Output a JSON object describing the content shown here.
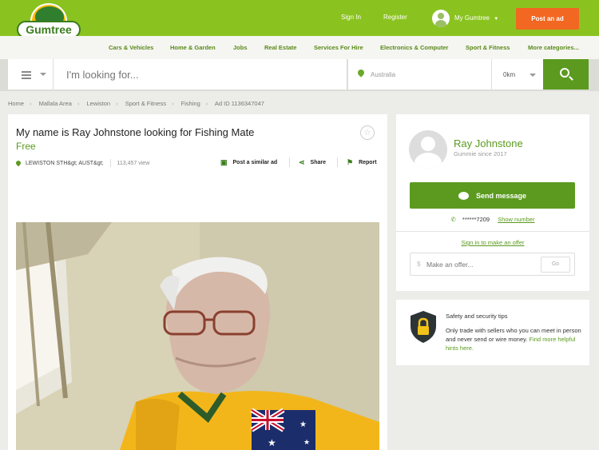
{
  "header": {
    "logo_text": "Gumtree",
    "sign_in": "Sign In",
    "register": "Register",
    "my_gumtree": "My Gumtree",
    "post_ad": "Post an ad"
  },
  "categories": [
    "Cars & Vehicles",
    "Home & Garden",
    "Jobs",
    "Real Estate",
    "Services For Hire",
    "Electronics & Computer",
    "Sport & Fitness",
    "More categories..."
  ],
  "search": {
    "placeholder": "I'm looking for...",
    "location": "Australia",
    "radius": "0km"
  },
  "breadcrumb": [
    "Home",
    "Mallala Area",
    "Lewiston",
    "Sport & Fitness",
    "Fishing",
    "Ad ID 1136347047"
  ],
  "ad": {
    "title": "My name is Ray Johnstone looking for Fishing Mate",
    "price": "Free",
    "location": "LEWISTON STH&gt; AUST&gt;",
    "views": "113,457 view",
    "post_similar": "Post a similar ad",
    "share": "Share",
    "report": "Report"
  },
  "seller": {
    "name": "Ray Johnstone",
    "since": "Gummie since 2017",
    "send_message": "Send message",
    "phone_masked": "******7209",
    "show_number": "Show number",
    "sign_in_offer": "Sign in to make an offer",
    "offer_currency": "$",
    "offer_placeholder": "Make an offer...",
    "go": "Go"
  },
  "safety": {
    "title": "Safety and security tips",
    "text": "Only trade with sellers who you can meet in person and never send or wire money.",
    "link": "Find more helpful hints here."
  },
  "colors": {
    "brand_green": "#8ac31f",
    "dark_green": "#5b9a1f",
    "post_orange": "#f26722"
  }
}
